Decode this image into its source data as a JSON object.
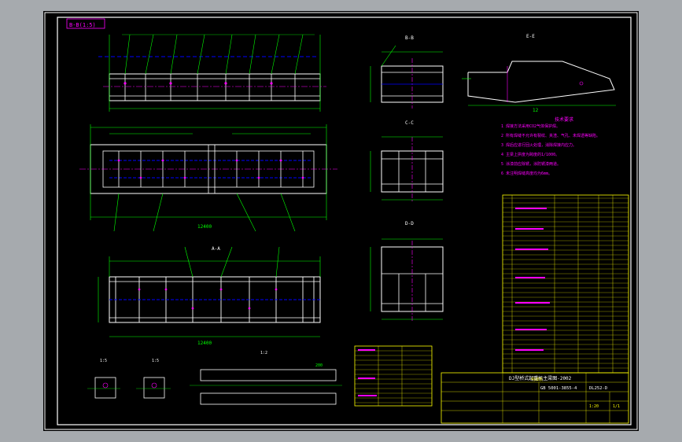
{
  "drawing": {
    "view_tag": "B-B(1:5)",
    "section_labels": [
      "A-A",
      "B-B",
      "C-C",
      "D-D",
      "E-E"
    ],
    "detail_labels": [
      "1:5",
      "1:5",
      "1:2"
    ],
    "dims": {
      "top_length": "12400",
      "mid_length": "12400",
      "bot_length": "12400",
      "sec_width": "1000",
      "sec_height": "960",
      "beam_len": "12",
      "detail_dim": "500",
      "plate_dim": "200"
    },
    "notes_title": "技术要求",
    "notes": [
      "1 焊接方法采用CO2气体保护焊。",
      "2 所有焊缝不允许有裂纹、夹渣、气孔、未焊透等缺陷。",
      "3 焊后应进行回火处理，消除焊接内应力。",
      "4 主梁上拱度为跨度的1/1000。",
      "5 涂漆前应除锈，涂防锈漆两道。",
      "6 未注明焊缝高度均为6mm。"
    ],
    "title_block": {
      "company": "DJ型桥式起重机主梁图-2002",
      "drawing_no": "GB 5001-3855-4",
      "part_code": "DL252-D",
      "scale": "1:20",
      "sheet": "1/1"
    },
    "table_header": "明细表"
  },
  "colors": {
    "background": "#000000",
    "frame": "#ffffff",
    "outline": "#ffffff",
    "dimension": "#00ff00",
    "hidden": "#0000ff",
    "centerline": "#ff00ff",
    "table": "#ffff00",
    "annotation": "#ff00ff",
    "highlight": "#00ffff"
  }
}
